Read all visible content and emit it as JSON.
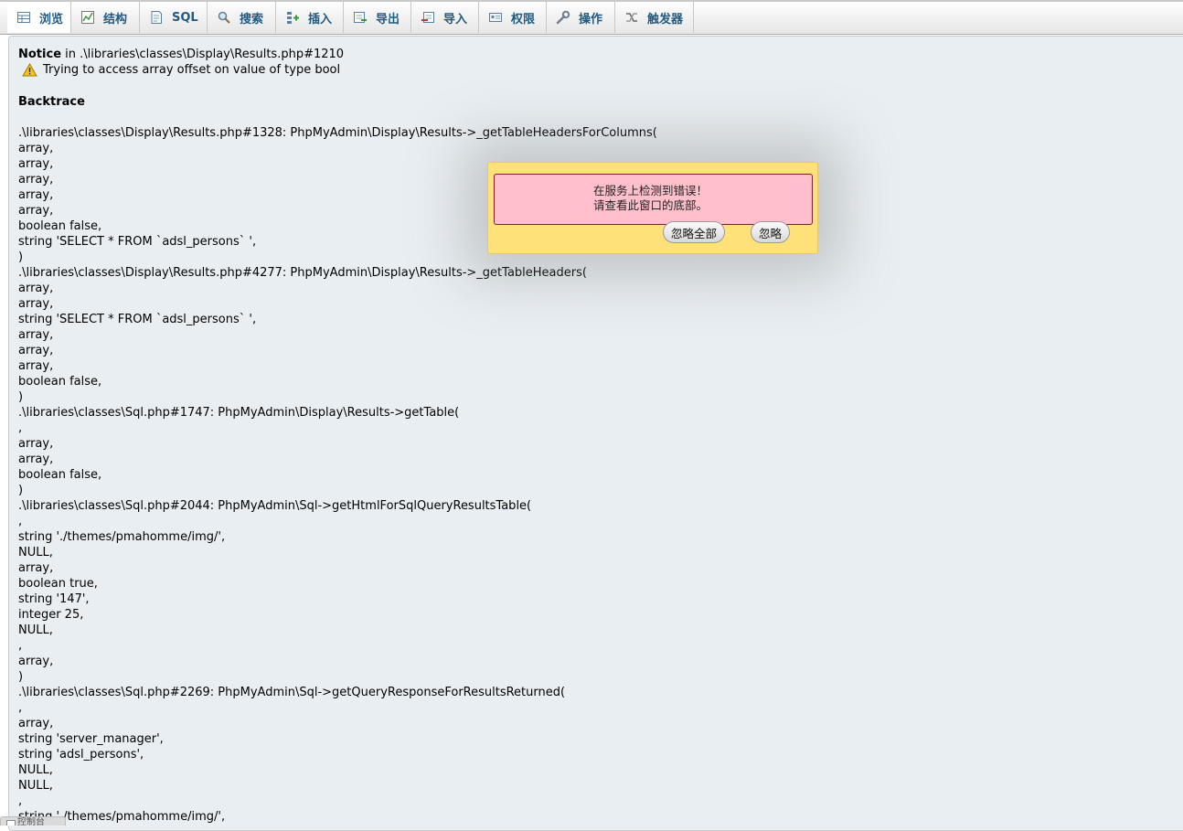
{
  "tabs": [
    {
      "label": "浏览",
      "icon": "browse-table-icon",
      "active": true
    },
    {
      "label": "结构",
      "icon": "structure-chart-icon"
    },
    {
      "label": "SQL",
      "icon": "sql-document-icon"
    },
    {
      "label": "搜索",
      "icon": "search-magnifier-icon"
    },
    {
      "label": "插入",
      "icon": "insert-row-icon"
    },
    {
      "label": "导出",
      "icon": "export-icon"
    },
    {
      "label": "导入",
      "icon": "import-icon"
    },
    {
      "label": "权限",
      "icon": "privileges-card-icon"
    },
    {
      "label": "操作",
      "icon": "wrench-icon"
    },
    {
      "label": "触发器",
      "icon": "triggers-icon"
    }
  ],
  "notice": {
    "label": "Notice",
    "location": " in .\\libraries\\classes\\Display\\Results.php#1210",
    "message": "Trying to access array offset on value of type bool"
  },
  "backtrace": {
    "title": "Backtrace",
    "lines": [
      ".\\libraries\\classes\\Display\\Results.php#1328: PhpMyAdmin\\Display\\Results->_getTableHeadersForColumns(",
      "array,",
      "array,",
      "array,",
      "array,",
      "array,",
      "boolean false,",
      "string 'SELECT * FROM `adsl_persons` ',",
      ")",
      ".\\libraries\\classes\\Display\\Results.php#4277: PhpMyAdmin\\Display\\Results->_getTableHeaders(",
      "array,",
      "array,",
      "string 'SELECT * FROM `adsl_persons` ',",
      "array,",
      "array,",
      "array,",
      "boolean false,",
      ")",
      ".\\libraries\\classes\\Sql.php#1747: PhpMyAdmin\\Display\\Results->getTable(",
      ",",
      "array,",
      "array,",
      "boolean false,",
      ")",
      ".\\libraries\\classes\\Sql.php#2044: PhpMyAdmin\\Sql->getHtmlForSqlQueryResultsTable(",
      ",",
      "string './themes/pmahomme/img/',",
      "NULL,",
      "array,",
      "boolean true,",
      "string '147',",
      "integer 25,",
      "NULL,",
      ",",
      "array,",
      ")",
      ".\\libraries\\classes\\Sql.php#2269: PhpMyAdmin\\Sql->getQueryResponseForResultsReturned(",
      ",",
      "array,",
      "string 'server_manager',",
      "string 'adsl_persons',",
      "NULL,",
      "NULL,",
      ",",
      "string './themes/pmahomme/img/',"
    ]
  },
  "error_dialog": {
    "line1": "在服务上检测到错误！",
    "line2": "请查看此窗口的底部。",
    "ignore_all_label": "忽略全部",
    "ignore_label": "忽略"
  },
  "bottom_widget": {
    "label": "控制台"
  },
  "colors": {
    "tab_text": "#235a81",
    "content_bg": "#e8eef2",
    "dialog_bg": "#ffe17a",
    "dialog_message_bg": "#ffc0cb",
    "dialog_message_border": "#7d1f2f"
  }
}
